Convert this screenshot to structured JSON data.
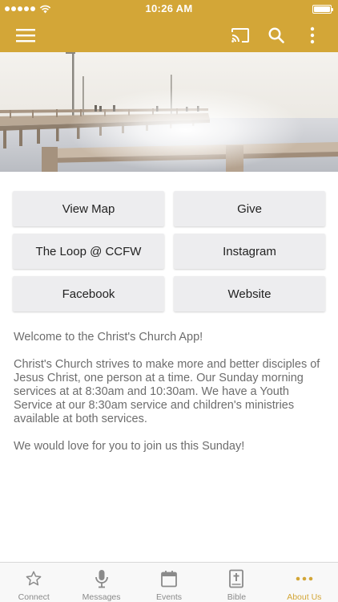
{
  "status_bar": {
    "time": "10:26 AM"
  },
  "toolbar": {
    "menu_icon": "hamburger-menu-icon",
    "cast_icon": "cast-icon",
    "search_icon": "search-icon",
    "more_icon": "more-vertical-icon"
  },
  "colors": {
    "accent": "#d3a637",
    "button_bg": "#ededef",
    "body_text": "#6d6d6d",
    "tab_inactive": "#8a8a8a"
  },
  "buttons": [
    {
      "label": "View Map"
    },
    {
      "label": "Give"
    },
    {
      "label": "The Loop @ CCFW"
    },
    {
      "label": "Instagram"
    },
    {
      "label": "Facebook"
    },
    {
      "label": "Website"
    }
  ],
  "content": {
    "welcome": "Welcome to the Christ's Church App!",
    "description": "Christ's Church strives to make more and better disciples of Jesus Christ, one person at a time. Our Sunday morning services at at 8:30am and 10:30am. We have a Youth Service at our 8:30am service and children's ministries available at both services.",
    "invite": "We would love for you to join us this Sunday!"
  },
  "tabs": [
    {
      "label": "Connect",
      "icon": "star-icon",
      "active": false
    },
    {
      "label": "Messages",
      "icon": "microphone-icon",
      "active": false
    },
    {
      "label": "Events",
      "icon": "calendar-icon",
      "active": false
    },
    {
      "label": "Bible",
      "icon": "bible-icon",
      "active": false
    },
    {
      "label": "About Us",
      "icon": "more-horizontal-icon",
      "active": true
    }
  ]
}
